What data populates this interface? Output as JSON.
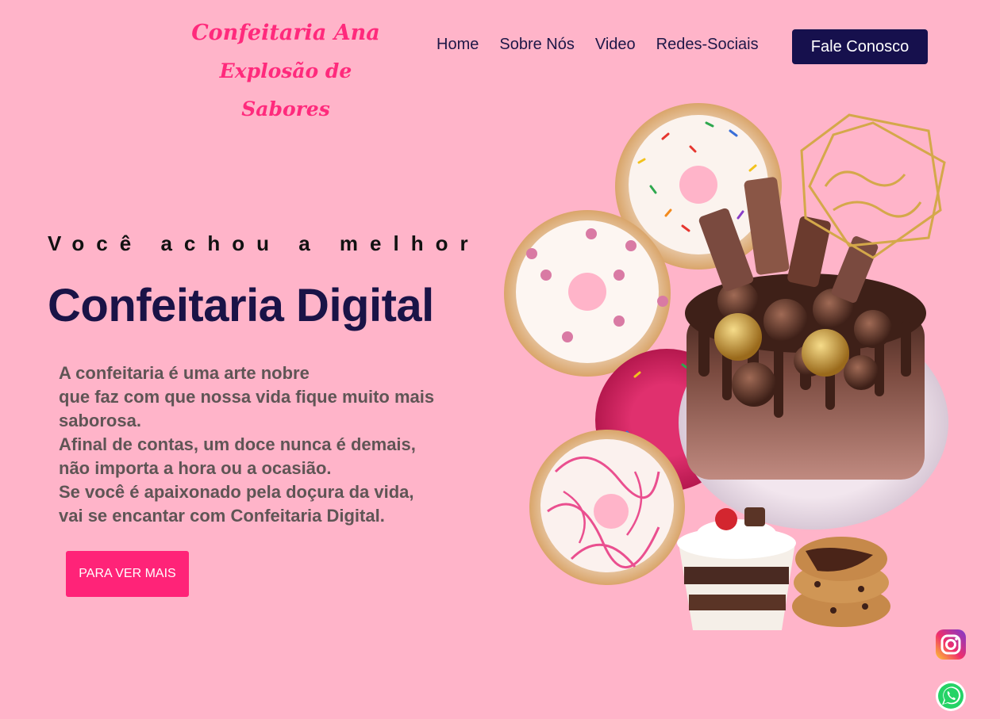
{
  "brand": {
    "line1": "Confeitaria Ana",
    "line2": "Explosão de Sabores"
  },
  "nav": {
    "items": [
      "Home",
      "Sobre Nós",
      "Video",
      "Redes-Sociais"
    ],
    "cta_label": "Fale Conosco"
  },
  "hero": {
    "subtitle": "Você achou a melhor",
    "title": "Confeitaria Digital",
    "description": [
      "A confeitaria é uma arte nobre",
      "que faz com que nossa vida fique muito mais",
      "saborosa.",
      "Afinal de contas, um doce nunca é demais,",
      "não importa a hora ou a ocasião.",
      "Se você é apaixonado pela doçura da vida,",
      "vai se encantar com Confeitaria Digital."
    ],
    "button_label": "PARA VER MAIS",
    "image": "donuts-and-chocolate-cake-image"
  },
  "social": {
    "instagram_icon": "instagram-icon",
    "whatsapp_icon": "whatsapp-icon"
  },
  "colors": {
    "background": "#ffb4c9",
    "brand": "#ff2a7c",
    "navy": "#16104d",
    "accent_button": "#ff2378",
    "body_text": "#5f5555"
  }
}
